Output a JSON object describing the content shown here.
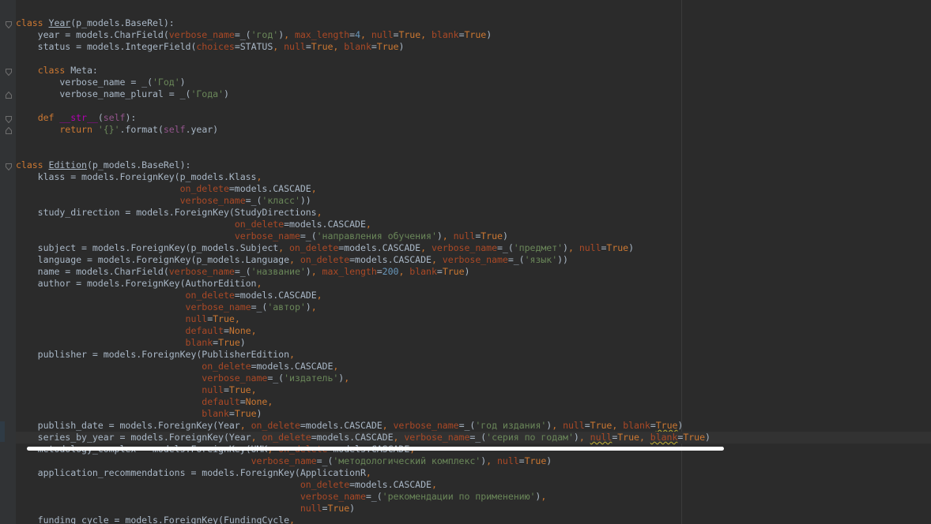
{
  "editor": {
    "language": "python",
    "theme": "darcula",
    "colors": {
      "background": "#2b2b2b",
      "keyword": "#cc7832",
      "string": "#6a8759",
      "number": "#6897bb",
      "parameter": "#aa4926",
      "self": "#94558d",
      "dunder": "#b200b2",
      "text": "#a9b7c6"
    },
    "lines": [
      "class Year(p_models.BaseRel):",
      "    year = models.CharField(verbose_name=_('год'), max_length=4, null=True, blank=True)",
      "    status = models.IntegerField(choices=STATUS, null=True, blank=True)",
      "",
      "    class Meta:",
      "        verbose_name = _('Год')",
      "        verbose_name_plural = _('Года')",
      "",
      "    def __str__(self):",
      "        return '{}'.format(self.year)",
      "",
      "",
      "class Edition(p_models.BaseRel):",
      "    klass = models.ForeignKey(p_models.Klass,",
      "                              on_delete=models.CASCADE,",
      "                              verbose_name=_('класс'))",
      "    study_direction = models.ForeignKey(StudyDirections,",
      "                                        on_delete=models.CASCADE,",
      "                                        verbose_name=_('направления обучения'), null=True)",
      "    subject = models.ForeignKey(p_models.Subject, on_delete=models.CASCADE, verbose_name=_('предмет'), null=True)",
      "    language = models.ForeignKey(p_models.Language, on_delete=models.CASCADE, verbose_name=_('язык'))",
      "    name = models.CharField(verbose_name=_('название'), max_length=200, blank=True)",
      "    author = models.ForeignKey(AuthorEdition,",
      "                               on_delete=models.CASCADE,",
      "                               verbose_name=_('автор'),",
      "                               null=True,",
      "                               default=None,",
      "                               blank=True)",
      "    publisher = models.ForeignKey(PublisherEdition,",
      "                                  on_delete=models.CASCADE,",
      "                                  verbose_name=_('издатель'),",
      "                                  null=True,",
      "                                  default=None,",
      "                                  blank=True)",
      "    publish_date = models.ForeignKey(Year, on_delete=models.CASCADE, verbose_name=_('год издания'), null=True, blank=True)",
      "    series_by_year = models.ForeignKey(Year, on_delete=models.CASCADE, verbose_name=_('серия по годам'), null=True, blank=True)",
      "    metodology_complex = models.ForeignKey(UMK, on_delete=models.CASCADE,",
      "                                           verbose_name=_('методологический комплекс'), null=True)",
      "    application_recommendations = models.ForeignKey(ApplicationR,",
      "                                                    on_delete=models.CASCADE,",
      "                                                    verbose_name=_('рекомендации по применению'),",
      "                                                    null=True)",
      "    funding_cycle = models.ForeignKey(FundingCycle,"
    ]
  }
}
